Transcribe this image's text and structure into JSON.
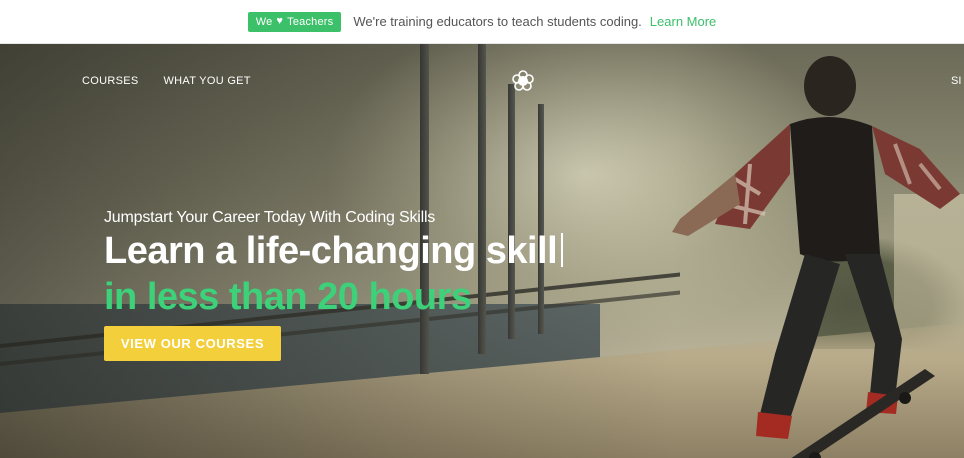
{
  "announcement": {
    "badge_prefix": "We",
    "badge_suffix": "Teachers",
    "text": "We're training educators to teach students coding.",
    "link": "Learn More"
  },
  "nav": {
    "left_items": [
      "COURSES",
      "WHAT YOU GET"
    ],
    "right_item": "SI",
    "logo_icon": "flower-logo-icon"
  },
  "hero": {
    "tagline": "Jumpstart Your Career Today With Coding Skills",
    "headline_line1": "Learn a life-changing skill",
    "headline_line2": "in less than 20 hours",
    "cta_label": "VIEW OUR COURSES"
  },
  "colors": {
    "accent_green": "#3cc06a",
    "headline_green": "#3dd17a",
    "cta_yellow": "#f3cf3b"
  }
}
